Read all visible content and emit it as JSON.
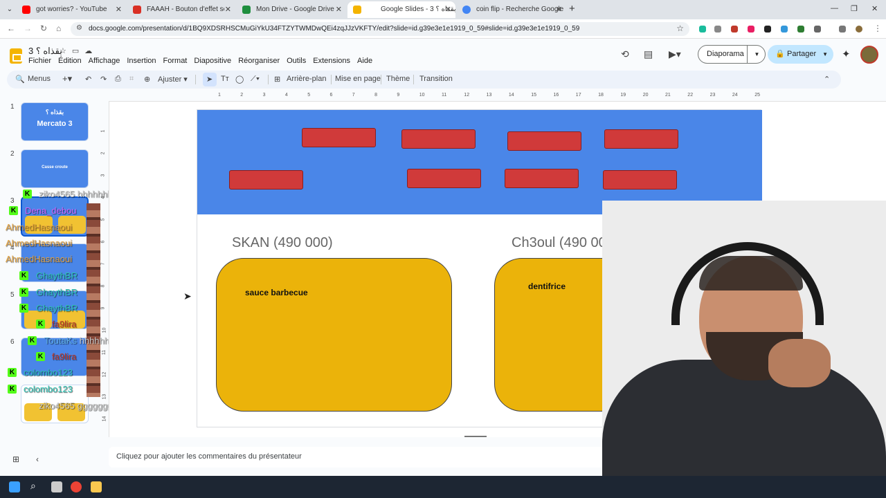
{
  "browser": {
    "tabs": [
      {
        "title": "got worries? - YouTube",
        "favicon_color": "#ff0000"
      },
      {
        "title": "FAAAH - Bouton d'effet sonore",
        "favicon_color": "#d93025"
      },
      {
        "title": "Mon Drive - Google Drive",
        "favicon_color": "#1e8e3e"
      },
      {
        "title": "Google Slides - ‫بقذاه ؟ 3‬",
        "favicon_color": "#f4b400"
      },
      {
        "title": "coin flip - Recherche Google",
        "favicon_color": "#4285f4"
      }
    ],
    "active_tab_index": 3,
    "url": "docs.google.com/presentation/d/1BQ9XDSRHSCMuGiYkU34FTZYTWMDwQEi4zqJJzVKFTY/edit?slide=id.g39e3e1e1919_0_59#slide=id.g39e3e1e1919_0_59"
  },
  "app": {
    "title": "‫بقذاه ؟ 3‬",
    "menu": [
      "Fichier",
      "Édition",
      "Affichage",
      "Insertion",
      "Format",
      "Diapositive",
      "Réorganiser",
      "Outils",
      "Extensions",
      "Aide"
    ],
    "slideshow_label": "Diaporama",
    "share_label": "Partager"
  },
  "toolbar": {
    "menus_label": "Menus",
    "zoom_label": "Ajuster",
    "background_label": "Arrière-plan",
    "layout_label": "Mise en page",
    "theme_label": "Thème",
    "transition_label": "Transition"
  },
  "filmstrip": {
    "slides": [
      {
        "num": "1",
        "line1": "‫بقذاه ؟‬",
        "line2": "Mercato 3"
      },
      {
        "num": "2",
        "line1": "Casse croute",
        "line2": ""
      },
      {
        "num": "3",
        "line1": "",
        "line2": ""
      },
      {
        "num": "4",
        "line1": "",
        "line2": ""
      },
      {
        "num": "5",
        "line1": "",
        "line2": ""
      },
      {
        "num": "6",
        "line1": "",
        "line2": ""
      }
    ]
  },
  "chat": [
    {
      "user": "ziko4565",
      "msg": "hhhhhhhhhhh",
      "color": "#cccccc"
    },
    {
      "user": "Dena_debou",
      "msg": "",
      "color": "#cc66ff"
    },
    {
      "user": "AhmedHasnaoui",
      "msg": "",
      "color": "#e6a23c"
    },
    {
      "user": "AhmedHasnaoui",
      "msg": "",
      "color": "#e6a23c"
    },
    {
      "user": "AhmedHasnaoui",
      "msg": "",
      "color": "#e6a23c"
    },
    {
      "user": "GhaythBR",
      "msg": "",
      "color": "#2ec4b6"
    },
    {
      "user": "GhaythBR",
      "msg": "",
      "color": "#2ec4b6"
    },
    {
      "user": "GhaythBR",
      "msg": "",
      "color": "#2ec4b6"
    },
    {
      "user": "fa9lira",
      "msg": "",
      "color": "#c0392b"
    },
    {
      "user": "ToutaKs",
      "msg": "hhhhhhhhhhh",
      "color": "#5dade2"
    },
    {
      "user": "fa9lira",
      "msg": "",
      "color": "#c0392b"
    },
    {
      "user": "colombo123",
      "msg": "",
      "color": "#2ec4b6"
    },
    {
      "user": "colombo123",
      "msg": "",
      "color": "#2ec4b6"
    },
    {
      "user": "ziko4565",
      "msg": "ggggggggggg",
      "color": "#cccccc"
    }
  ],
  "slide": {
    "banner_color": "#4a86e8",
    "box_color": "#d03a3a",
    "card_color": "#ebb30a",
    "left_title": "SKAN (490 000)",
    "right_title": "Ch3oul (490 000)",
    "left_card_text": "sauce barbecue",
    "right_card_text": "dentifrice"
  },
  "ruler": {
    "h_ticks": [
      "1",
      "2",
      "3",
      "4",
      "5",
      "6",
      "7",
      "8",
      "9",
      "10",
      "11",
      "12",
      "13",
      "14",
      "15",
      "16",
      "17",
      "18",
      "19",
      "20",
      "21",
      "22",
      "23",
      "24",
      "25"
    ],
    "v_ticks": [
      "1",
      "2",
      "3",
      "4",
      "5",
      "6",
      "7",
      "8",
      "9",
      "10",
      "11",
      "12",
      "13",
      "14"
    ]
  },
  "notes": {
    "placeholder": "Cliquez pour ajouter les commentaires du présentateur"
  }
}
